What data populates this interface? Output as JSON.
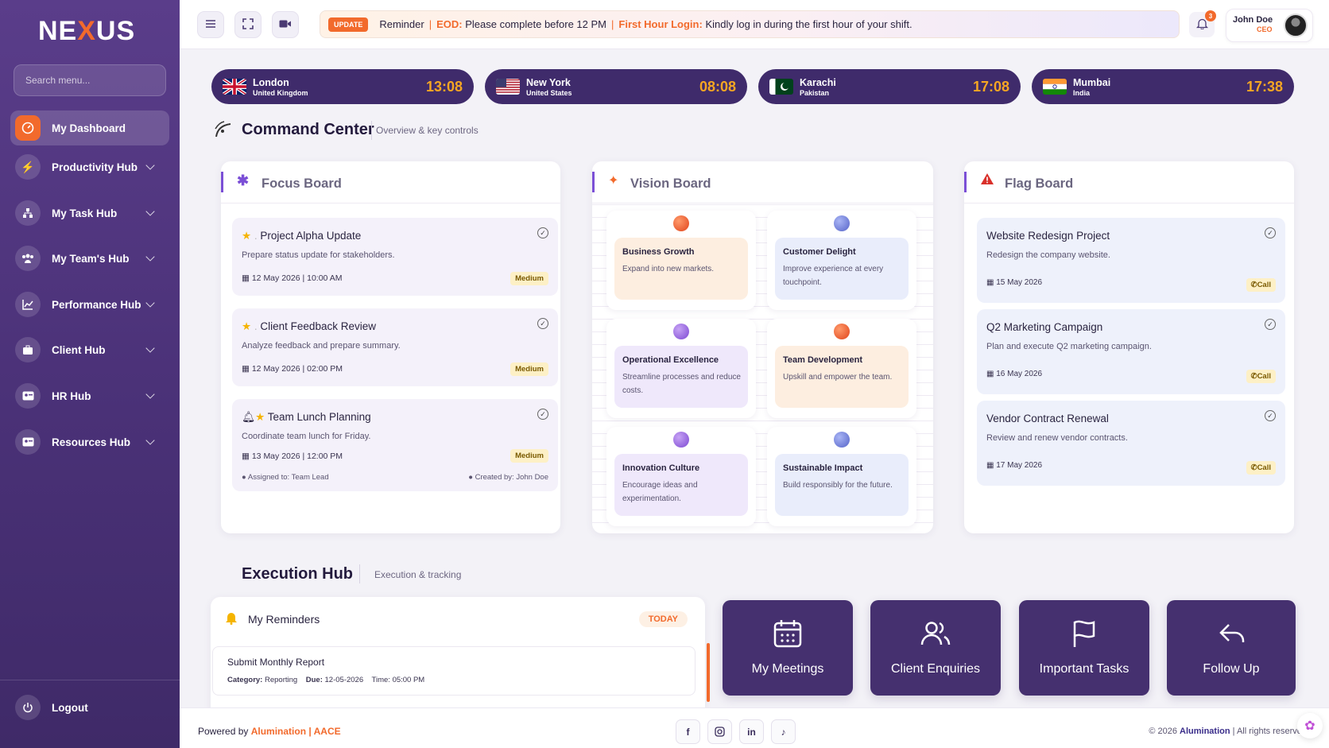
{
  "app": {
    "logo": "NEXUS",
    "logo_pre": "NE",
    "logo_x": "X",
    "logo_post": "US"
  },
  "sidebar": {
    "search_placeholder": "Search menu...",
    "items": [
      {
        "label": "My Dashboard",
        "icon": "dashboard-gauge-icon",
        "active": true
      },
      {
        "label": "Productivity Hub",
        "icon": "lightning-icon"
      },
      {
        "label": "My Task Hub",
        "icon": "sitemap-icon"
      },
      {
        "label": "My Team's Hub",
        "icon": "team-icon"
      },
      {
        "label": "Performance Hub",
        "icon": "line-chart-icon"
      },
      {
        "label": "Client Hub",
        "icon": "briefcase-icon"
      },
      {
        "label": "HR Hub",
        "icon": "id-card-icon"
      },
      {
        "label": "Resources Hub",
        "icon": "id-card-icon"
      }
    ],
    "logout": "Logout"
  },
  "topbar": {
    "update_badge": "UPDATE",
    "reminder": "Reminder",
    "eod_label": "EOD:",
    "eod_text": "Please complete before 12 PM",
    "login_label": "First Hour Login:",
    "login_text": "Kindly log in during the first hour of your shift.",
    "notifications": "3",
    "user_name": "John Doe",
    "user_role": "CEO"
  },
  "clocks": [
    {
      "city": "London",
      "country": "United Kingdom",
      "time": "13:08",
      "flag": "uk"
    },
    {
      "city": "New York",
      "country": "United States",
      "time": "08:08",
      "flag": "us"
    },
    {
      "city": "Karachi",
      "country": "Pakistan",
      "time": "17:08",
      "flag": "pk"
    },
    {
      "city": "Mumbai",
      "country": "India",
      "time": "17:38",
      "flag": "in"
    }
  ],
  "command_center": {
    "title": "Command Center",
    "subtitle": "Overview & key controls"
  },
  "focus_board": {
    "title": "Focus Board",
    "cards": [
      {
        "title": "Project Alpha Update",
        "desc": "Prepare status update for stakeholders.",
        "date": "12 May 2026 | 10:00 AM",
        "priority": "Medium"
      },
      {
        "title": "Client Feedback Review",
        "desc": "Analyze feedback and prepare summary.",
        "date": "12 May 2026 | 02:00 PM",
        "priority": "Medium"
      },
      {
        "title": "Team Lunch Planning",
        "desc": "Coordinate team lunch for Friday.",
        "date": "13 May 2026 | 12:00 PM",
        "priority": "Medium",
        "assigned": "Assigned to: Team Lead",
        "created": "Created by: John Doe"
      }
    ]
  },
  "vision_board": {
    "title": "Vision Board",
    "items": [
      {
        "title": "Business Growth",
        "desc": "Expand into new markets.",
        "tone": "orange"
      },
      {
        "title": "Customer Delight",
        "desc": "Improve experience at every touchpoint.",
        "tone": "blue"
      },
      {
        "title": "Operational Excellence",
        "desc": "Streamline processes and reduce costs.",
        "tone": "purple"
      },
      {
        "title": "Team Development",
        "desc": "Upskill and empower the team.",
        "tone": "orange"
      },
      {
        "title": "Innovation Culture",
        "desc": "Encourage ideas and experimentation.",
        "tone": "purple"
      },
      {
        "title": "Sustainable Impact",
        "desc": "Build responsibly for the future.",
        "tone": "blue"
      }
    ]
  },
  "flag_board": {
    "title": "Flag Board",
    "cards": [
      {
        "title": "Website Redesign Project",
        "desc": "Redesign the company website.",
        "date": "15 May 2026",
        "action": "Call"
      },
      {
        "title": "Q2 Marketing Campaign",
        "desc": "Plan and execute Q2 marketing campaign.",
        "date": "16 May 2026",
        "action": "Call"
      },
      {
        "title": "Vendor Contract Renewal",
        "desc": "Review and renew vendor contracts.",
        "date": "17 May 2026",
        "action": "Call"
      }
    ]
  },
  "execution_hub": {
    "title": "Execution Hub",
    "subtitle": "Execution & tracking"
  },
  "reminders": {
    "title": "My Reminders",
    "badge": "TODAY",
    "item_title": "Submit Monthly Report",
    "category_label": "Category:",
    "category": "Reporting",
    "due_label": "Due:",
    "due": "12-05-2026",
    "time_label": "Time:",
    "time": "05:00 PM"
  },
  "tiles": [
    {
      "label": "My Meetings",
      "icon": "calendar-icon"
    },
    {
      "label": "Client Enquiries",
      "icon": "users-icon"
    },
    {
      "label": "Important Tasks",
      "icon": "flag-icon"
    },
    {
      "label": "Follow Up",
      "icon": "reply-arrow-icon"
    }
  ],
  "footer": {
    "powered_by": "Powered by",
    "brand": "Alumination | AACE",
    "copyright_pre": "© 2026",
    "copyright_brand": "Alumination",
    "copyright_post": "| All rights reserved"
  },
  "colors": {
    "accent": "#f26a2c",
    "sidebar": "#4a3177",
    "tile": "#45306f",
    "clock_time": "#f5a623"
  }
}
